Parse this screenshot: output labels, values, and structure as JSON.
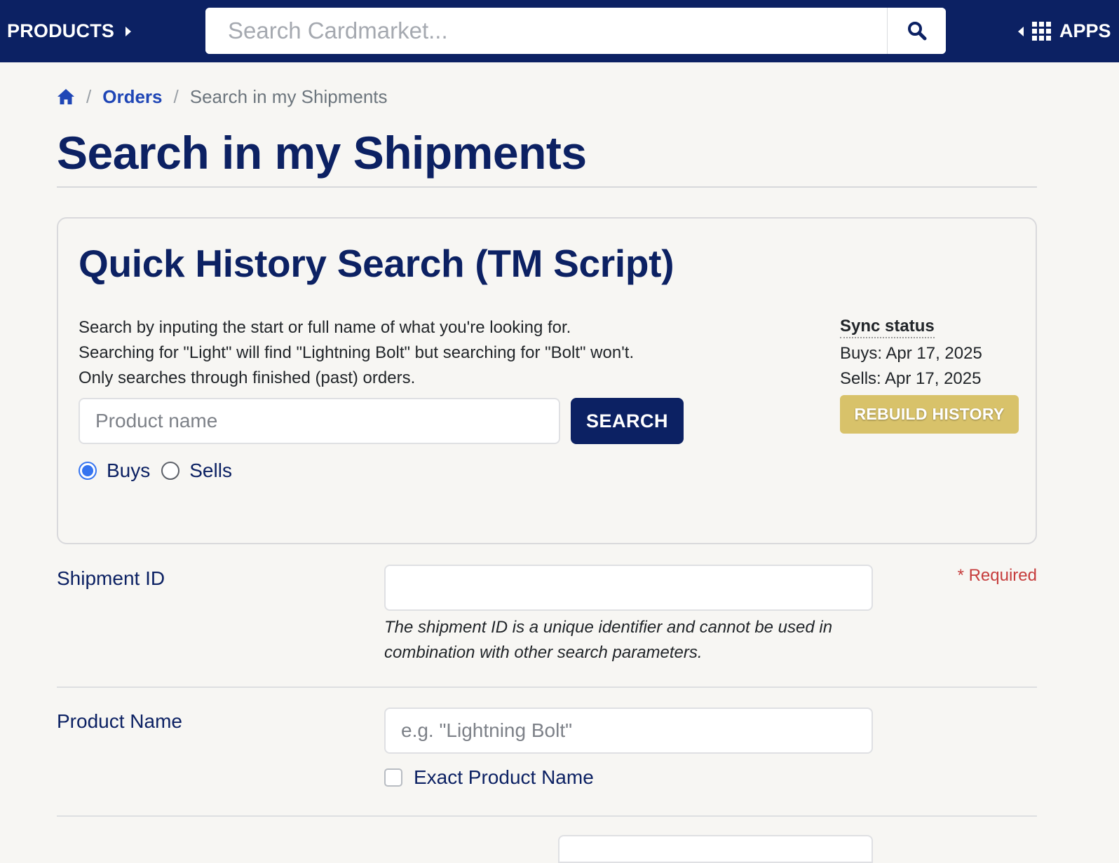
{
  "topbar": {
    "products_label": "PRODUCTS",
    "search_placeholder": "Search Cardmarket...",
    "apps_label": "APPS",
    "bg_color": "#0c2163"
  },
  "breadcrumb": {
    "home_icon": "home-icon",
    "orders": "Orders",
    "current": "Search in my Shipments"
  },
  "page": {
    "title": "Search in my Shipments"
  },
  "quick_history": {
    "title": "Quick History Search (TM Script)",
    "desc_lines": [
      "Search by inputing the start or full name of what you're looking for.",
      "Searching for \"Light\" will find \"Lightning Bolt\" but searching for \"Bolt\" won't.",
      "Only searches through finished (past) orders."
    ],
    "input_placeholder": "Product name",
    "search_button": "SEARCH",
    "radios": [
      {
        "label": "Buys",
        "checked": true
      },
      {
        "label": "Sells",
        "checked": false
      }
    ],
    "sync": {
      "title": "Sync status",
      "buys": "Buys: Apr 17, 2025",
      "sells": "Sells: Apr 17, 2025"
    },
    "rebuild_button": "REBUILD HISTORY",
    "rebuild_color": "#d8c26a"
  },
  "form": {
    "shipment_id": {
      "label": "Shipment ID",
      "value": "",
      "required": "* Required",
      "help": "The shipment ID is a unique identifier and cannot be used in combination with other search parameters."
    },
    "product_name": {
      "label": "Product Name",
      "placeholder": "e.g. \"Lightning Bolt\"",
      "exact_label": "Exact Product Name",
      "exact_checked": false
    }
  },
  "colors": {
    "brand_navy": "#0c2163",
    "link_blue": "#1f46b6",
    "required_red": "#c63c3c",
    "radio_blue": "#3574f0"
  }
}
